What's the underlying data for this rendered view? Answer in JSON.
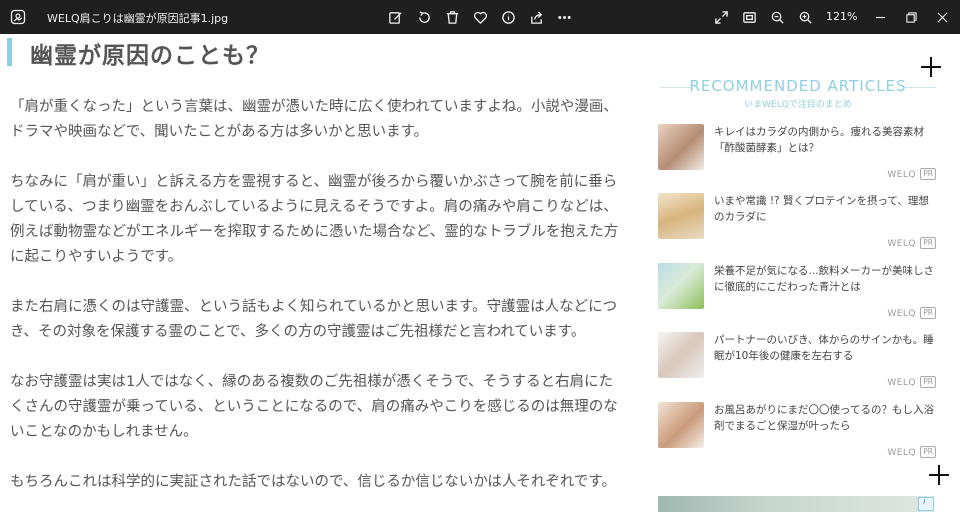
{
  "titlebar": {
    "filename": "WELQ肩こりは幽霊が原因記事1.jpg",
    "zoom": "121%",
    "icons": [
      "photos-app-icon",
      "edit-icon",
      "rotate-icon",
      "delete-icon",
      "favorite-icon",
      "info-icon",
      "share-icon",
      "more-icon",
      "fullscreen-icon",
      "fit-icon",
      "zoom-out-icon",
      "zoom-in-icon",
      "minimize-icon",
      "restore-icon",
      "close-icon"
    ]
  },
  "article": {
    "heading": "幽霊が原因のことも？",
    "paragraphs": [
      [
        "「肩が重くなった」という言葉は、幽霊が憑いた時に広く使われていますよね。小説や漫画、",
        "ドラマや映画などで、聞いたことがある方は多いかと思います。"
      ],
      [
        "ちなみに「肩が重い」と訴える方を霊視すると、幽霊が後ろから覆いかぶさって腕を前に垂ら",
        "している、つまり幽霊をおんぶしているように見えるそうですよ。肩の痛みや肩こりなどは、",
        "例えば動物霊などがエネルギーを搾取するために憑いた場合など、霊的なトラブルを抱えた方",
        "に起こりやすいようです。"
      ],
      [
        "また右肩に憑くのは守護霊、という話もよく知られているかと思います。守護霊は人などにつ",
        "き、その対象を保護する霊のことで、多くの方の守護霊はご先祖様だと言われています。"
      ],
      [
        "なお守護霊は実は1人ではなく、縁のある複数のご先祖様が憑くそうで、そうすると右肩にた",
        "くさんの守護霊が乗っている、ということになるので、肩の痛みやこりを感じるのは無理のな",
        "いことなのかもしれません。"
      ],
      [
        "もちろんこれは科学的に実証された話ではないので、信じるか信じないかは人それぞれです。"
      ]
    ]
  },
  "sidebar": {
    "title": "RECOMMENDED ARTICLES",
    "subtitle": "いまWELQで注目のまとめ",
    "cards": [
      {
        "text": "キレイはカラダの内側から。痩れる美容素材「酢酸菌酵素」とは？",
        "source": "WELQ",
        "pr": "PR"
      },
      {
        "text": "いまや常識 !? 賢くプロテインを摂って、理想のカラダに",
        "source": "WELQ",
        "pr": "PR"
      },
      {
        "text": "栄養不足が気になる...飲料メーカーが美味しさに徹底的にこだわった青汁とは",
        "source": "WELQ",
        "pr": "PR"
      },
      {
        "text": "パートナーのいびき、体からのサインかも。睡眠が10年後の健康を左右する",
        "source": "WELQ",
        "pr": "PR"
      },
      {
        "text": "お風呂あがりにまだ〇〇使ってるの？もし入浴剤でまるごと保湿が叶ったら",
        "source": "WELQ",
        "pr": "PR"
      }
    ]
  },
  "colors": {
    "accent": "#8ecfe6",
    "titlebar": "#1f1f1f",
    "text": "#555555"
  }
}
